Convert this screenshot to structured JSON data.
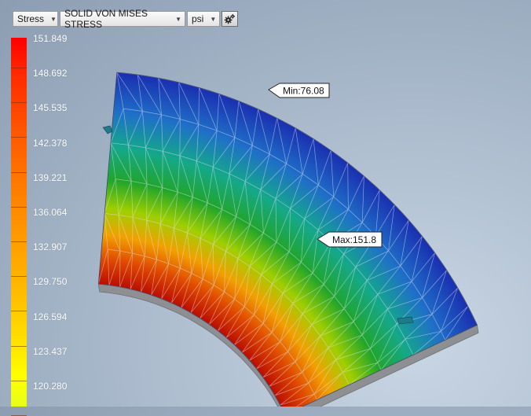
{
  "toolbar": {
    "result_type": "Stress",
    "result_component": "SOLID VON MISES STRESS",
    "unit": "psi",
    "settings_icon": "gear-icon"
  },
  "legend": {
    "labels": [
      "151.849",
      "148.692",
      "145.535",
      "142.378",
      "139.221",
      "136.064",
      "132.907",
      "129.750",
      "126.594",
      "123.437",
      "120.280"
    ],
    "colors": {
      "max": "#ff0000",
      "mid": "#ff9c00",
      "min": "#ffff00"
    }
  },
  "probes": {
    "min_label": "Min:76.08",
    "max_label": "Max:151.8"
  },
  "model": {
    "fringe_colors": [
      "#b80a00",
      "#e04a00",
      "#f2a000",
      "#9fcf00",
      "#21a52b",
      "#14a88a",
      "#1f6fc8",
      "#1a2fb0"
    ]
  }
}
